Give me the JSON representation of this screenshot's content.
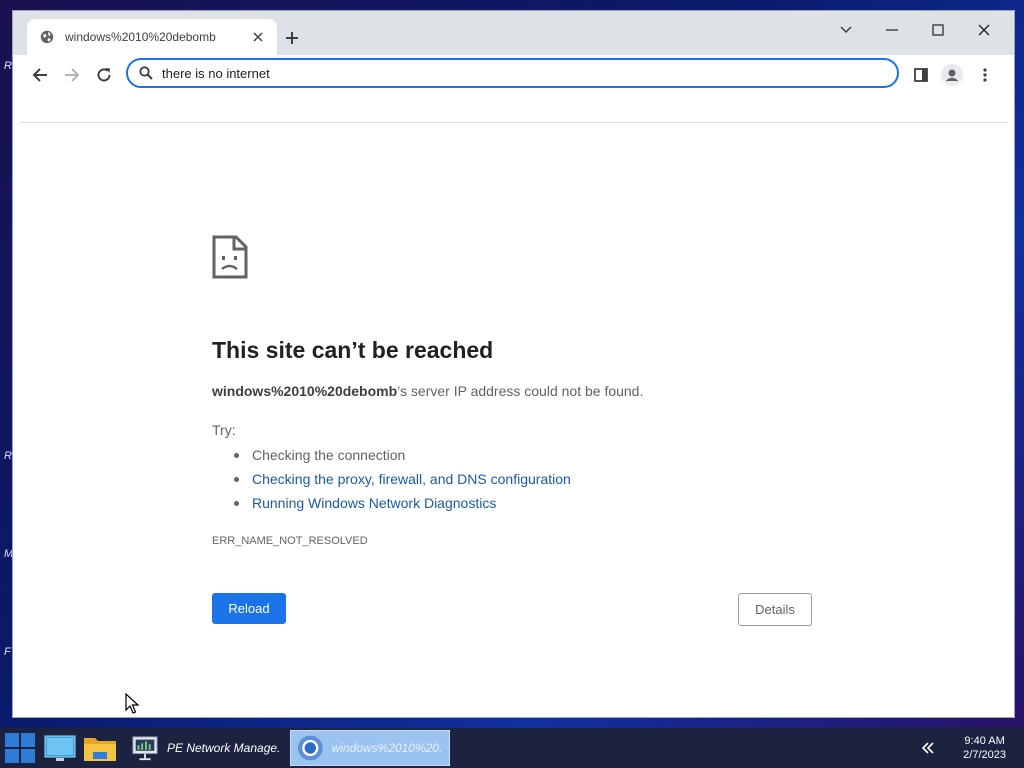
{
  "desktop": {
    "edge_fragments": [
      "R",
      "M",
      "F"
    ]
  },
  "browser": {
    "tab": {
      "title": "windows%2010%20debomb"
    },
    "omnibox": {
      "value": "there is no internet"
    }
  },
  "error_page": {
    "title": "This site can’t be reached",
    "host": "windows%2010%20debomb",
    "message_suffix": "’s server IP address could not be found.",
    "try_label": "Try:",
    "suggestions": [
      "Checking the connection",
      "Checking the proxy, firewall, and DNS configuration",
      "Running Windows Network Diagnostics"
    ],
    "error_code": "ERR_NAME_NOT_RESOLVED",
    "reload_label": "Reload",
    "details_label": "Details"
  },
  "taskbar": {
    "apps": [
      {
        "label": "PE Network Manage..."
      },
      {
        "label": "windows%2010%20..."
      }
    ],
    "clock_time": "9:40 AM",
    "clock_date": "2/7/2023"
  },
  "colors": {
    "accent": "#1a73e8",
    "link": "#1a5aaa",
    "taskbar": "#1b2340"
  }
}
